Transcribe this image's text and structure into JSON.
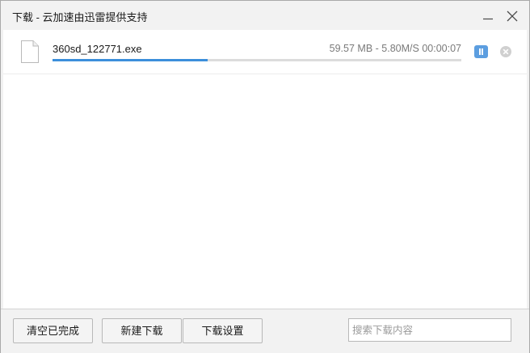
{
  "window": {
    "title": "下载 - 云加速由迅雷提供支持",
    "minimize_icon": "minimize-icon",
    "close_icon": "close-icon"
  },
  "downloads": [
    {
      "file_name": "360sd_122771.exe",
      "file_icon": "file-icon",
      "size": "59.57 MB",
      "separator": " - ",
      "speed": "5.80M/S",
      "time_remaining": "00:00:07",
      "progress": 0.38,
      "pause_icon": "pause-icon",
      "cancel_icon": "cancel-circle-icon"
    }
  ],
  "footer": {
    "clear_completed_label": "清空已完成",
    "new_download_label": "新建下载",
    "download_settings_label": "下载设置",
    "search_placeholder": "搜索下载内容"
  },
  "colors": {
    "accent": "#3c8fdb",
    "pause_button": "#5c9ee0"
  }
}
